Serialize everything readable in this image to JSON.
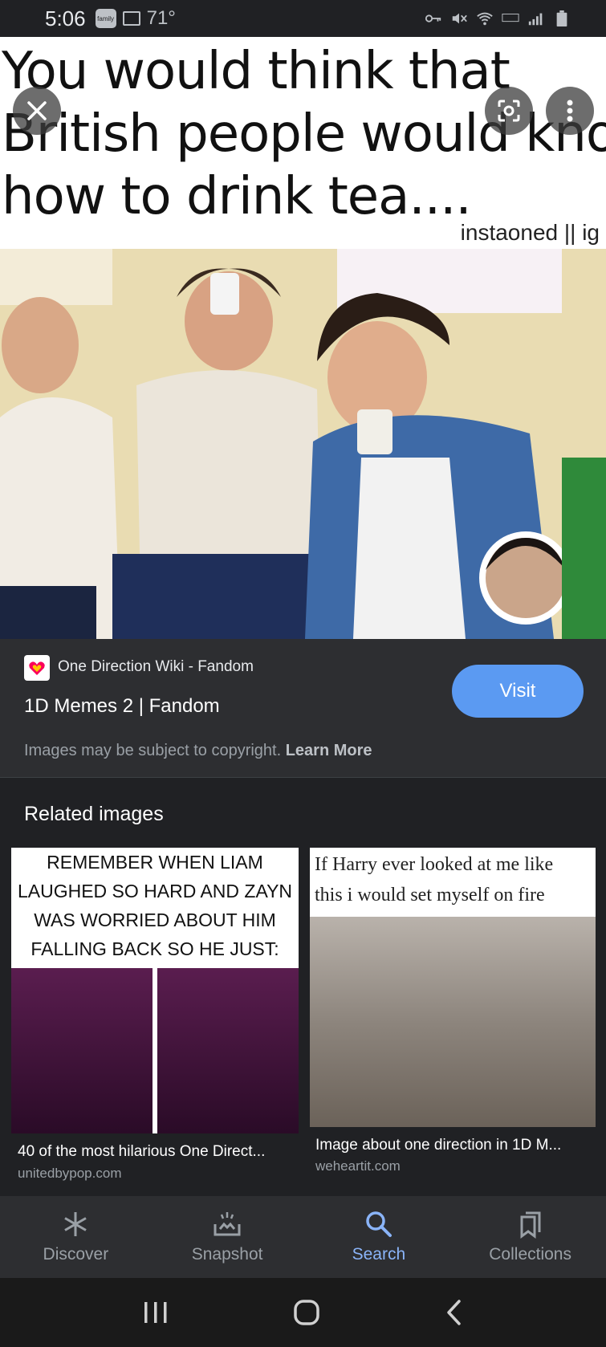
{
  "status_bar": {
    "time": "5:06",
    "temperature": "71°",
    "badge_text": "family"
  },
  "viewer": {
    "meme_line1": "You would think that",
    "meme_line2": "British people would know",
    "meme_line3": "how to drink tea....",
    "credit": "instaoned || ig",
    "close_icon": "close-icon",
    "lens_icon": "lens-icon",
    "more_icon": "more-vert-icon"
  },
  "source": {
    "site_name": "One Direction Wiki - Fandom",
    "title": "1D Memes 2 | Fandom",
    "visit_label": "Visit",
    "copyright_text": "Images may be subject to copyright.",
    "learn_more": "Learn More"
  },
  "related": {
    "heading": "Related images",
    "items": [
      {
        "caption_lines": [
          "REMEMBER WHEN LIAM",
          "LAUGHED SO HARD AND ZAYN",
          "WAS WORRIED ABOUT HIM",
          "FALLING BACK SO HE JUST:"
        ],
        "title": "40 of the most hilarious One Direct...",
        "domain": "unitedbypop.com"
      },
      {
        "caption_lines": [
          "If Harry ever looked at me like",
          "this i would set myself on fire"
        ],
        "title": "Image about one direction in 1D M...",
        "domain": "weheartit.com"
      }
    ]
  },
  "bottom_nav": {
    "items": [
      {
        "label": "Discover",
        "icon": "asterisk-icon"
      },
      {
        "label": "Snapshot",
        "icon": "snapshot-icon"
      },
      {
        "label": "Search",
        "icon": "search-icon",
        "active": true
      },
      {
        "label": "Collections",
        "icon": "collections-icon"
      }
    ]
  },
  "colors": {
    "accent": "#8ab4f8",
    "visit_button": "#5b9af2",
    "background": "#202124",
    "card": "#2d2e31"
  }
}
